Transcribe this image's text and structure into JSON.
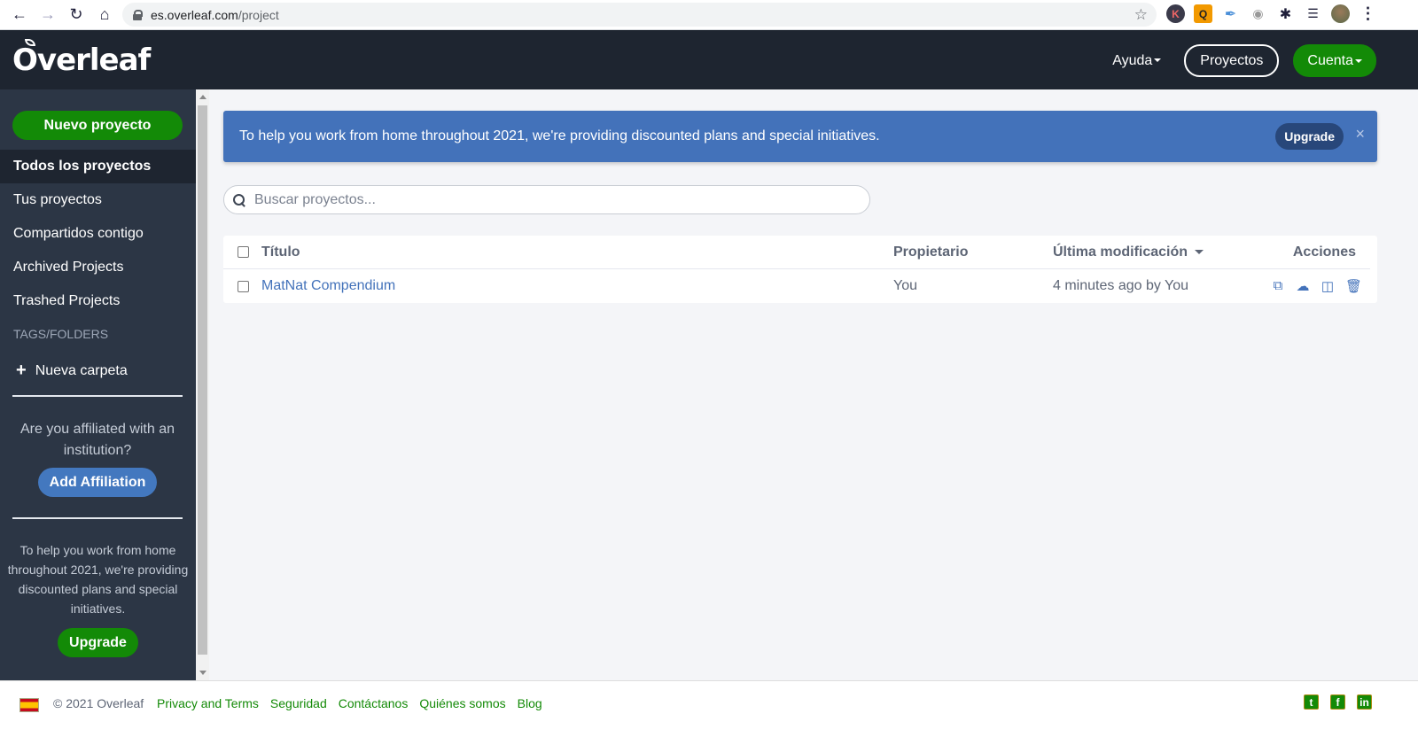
{
  "browser": {
    "url_host": "es.overleaf.com",
    "url_path": "/project",
    "icons": [
      "back-icon",
      "forward-icon",
      "reload-icon",
      "home-icon",
      "lock-icon",
      "star-icon"
    ],
    "extensions": [
      "k-extension-icon",
      "q-extension-icon",
      "feather-extension-icon",
      "camera-extension-icon",
      "puzzle-icon",
      "media-icon",
      "profile-avatar",
      "kebab-menu-icon"
    ]
  },
  "header": {
    "logo": "Overleaf",
    "help_label": "Ayuda",
    "projects_label": "Proyectos",
    "account_label": "Cuenta"
  },
  "sidebar": {
    "new_project_label": "Nuevo proyecto",
    "items": [
      {
        "label": "Todos los proyectos",
        "active": true
      },
      {
        "label": "Tus proyectos",
        "active": false
      },
      {
        "label": "Compartidos contigo",
        "active": false
      },
      {
        "label": "Archived Projects",
        "active": false
      },
      {
        "label": "Trashed Projects",
        "active": false
      }
    ],
    "tags_heading": "TAGS/FOLDERS",
    "new_folder_label": "Nueva carpeta",
    "affiliation_text": "Are you affiliated with an institution?",
    "add_affiliation_label": "Add Affiliation",
    "promo_text": "To help you work from home throughout 2021, we're providing discounted plans and special initiatives.",
    "upgrade_label": "Upgrade"
  },
  "banner": {
    "text": "To help you work from home throughout 2021, we're providing discounted plans and special initiatives.",
    "upgrade_label": "Upgrade",
    "close_symbol": "×"
  },
  "search": {
    "placeholder": "Buscar proyectos...",
    "value": ""
  },
  "table": {
    "columns": {
      "title": "Título",
      "owner": "Propietario",
      "last_modified": "Última modificación",
      "actions": "Acciones"
    },
    "sort_column": "last_modified",
    "rows": [
      {
        "title": "MatNat Compendium",
        "owner": "You",
        "last_modified": "4 minutes ago by You",
        "actions": [
          "copy-icon",
          "download-icon",
          "archive-icon",
          "trash-icon"
        ]
      }
    ]
  },
  "footer": {
    "language_flag": "es",
    "copyright": "© 2021 Overleaf",
    "links": [
      "Privacy and Terms",
      "Seguridad",
      "Contáctanos",
      "Quiénes somos",
      "Blog"
    ],
    "social": [
      "twitter-icon",
      "facebook-icon",
      "linkedin-icon"
    ]
  },
  "colors": {
    "brand_green": "#138a07",
    "header_bg": "#1e2530",
    "sidebar_bg": "#2c3645",
    "banner_blue": "#4372ba",
    "link_blue": "#4372ba"
  }
}
